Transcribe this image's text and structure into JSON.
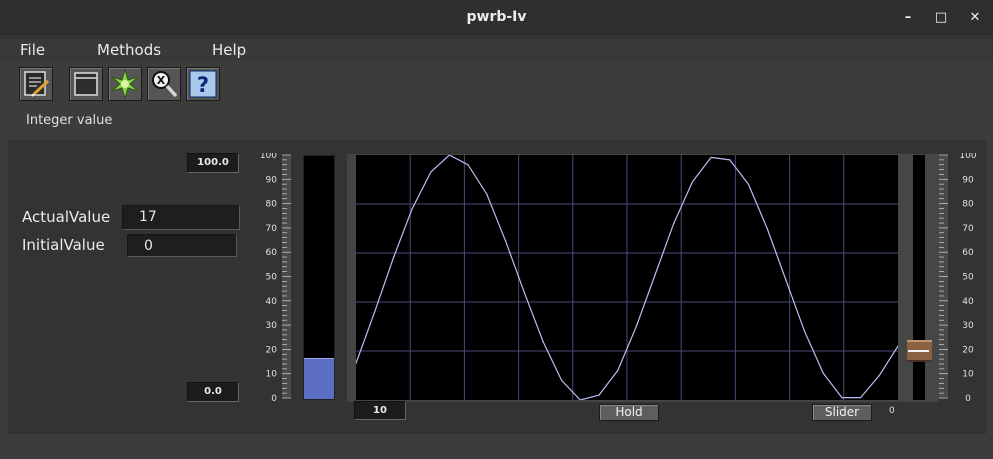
{
  "window": {
    "title": "pwrb-Iv",
    "minimize_glyph": "–",
    "maximize_glyph": "□",
    "close_glyph": "✕"
  },
  "menubar": {
    "items": [
      "File",
      "Methods",
      "Help"
    ]
  },
  "toolbar": {
    "buttons": [
      {
        "icon": "edit-notes-icon"
      },
      {
        "icon": "open-window-icon"
      },
      {
        "icon": "navigator-star-icon"
      },
      {
        "icon": "crossref-search-icon"
      },
      {
        "icon": "help-icon",
        "glyph": "?"
      }
    ],
    "status_text": "Integer value"
  },
  "fields": {
    "actual_label": "ActualValue",
    "actual_value": "17",
    "initial_label": "InitialValue",
    "initial_value": "0"
  },
  "bar": {
    "max_label": "100.0",
    "min_label": "0.0",
    "value": 17,
    "min": 0,
    "max": 100,
    "color": "#5c6ec4"
  },
  "scale_labels": [
    "100",
    "90",
    "80",
    "70",
    "60",
    "50",
    "40",
    "30",
    "20",
    "10",
    "0"
  ],
  "trend": {
    "time_range_value": "10",
    "hold_label": "Hold",
    "slider_label": "Slider",
    "slider_min_label": "0",
    "line_color": "#b8bff2",
    "grid_color": "#4a4a78"
  },
  "slider": {
    "value": 20,
    "min": 0,
    "max": 100
  },
  "chart_data": {
    "type": "line",
    "series": [
      {
        "values": [
          15,
          36,
          58,
          78,
          93,
          100,
          96,
          84,
          65,
          44,
          24,
          8,
          0,
          2,
          12,
          30,
          51,
          72,
          89,
          99,
          98,
          88,
          70,
          49,
          28,
          11,
          1,
          1,
          10,
          22
        ]
      }
    ],
    "x": [
      0,
      1,
      2,
      3,
      4,
      5,
      6,
      7,
      8,
      9,
      10,
      11,
      12,
      13,
      14,
      15,
      16,
      17,
      18,
      19,
      20,
      21,
      22,
      23,
      24,
      25,
      26,
      27,
      28,
      29
    ],
    "xlabel": "",
    "ylabel": "",
    "ylim": [
      0,
      100
    ],
    "grid": true
  }
}
